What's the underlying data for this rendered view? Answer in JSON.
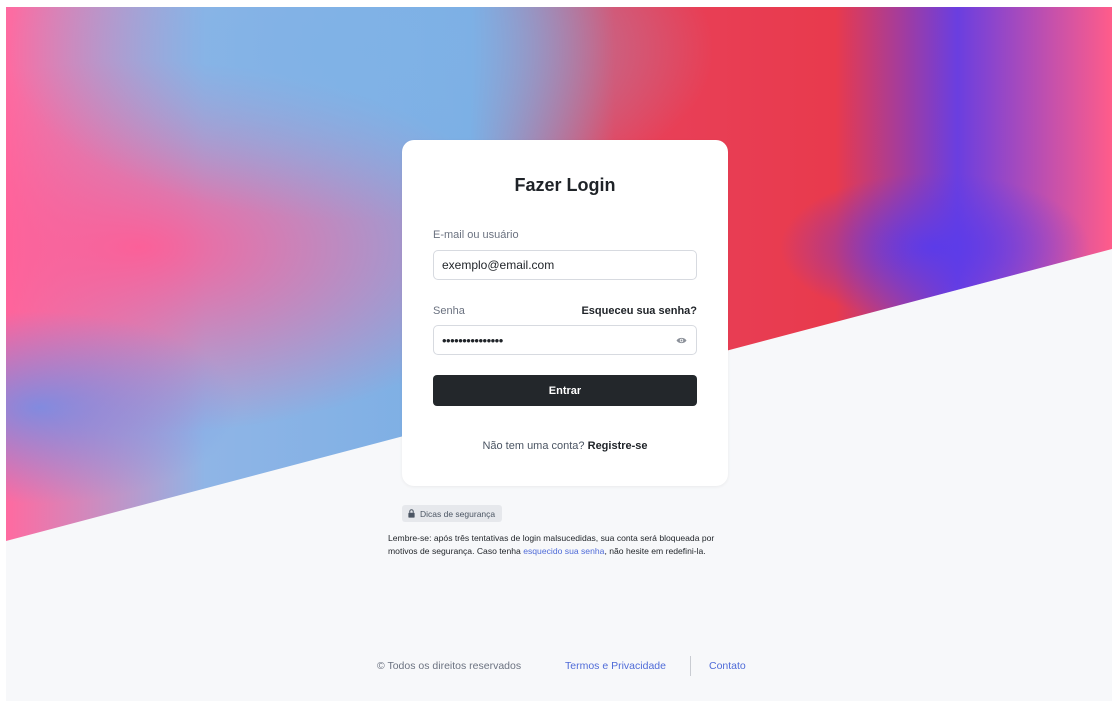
{
  "colors": {
    "accent": "#4f6bd8",
    "button_bg": "#23272b",
    "page_bg": "#f7f8fa",
    "card_bg": "#ffffff"
  },
  "login_card": {
    "title": "Fazer Login",
    "email_label": "E-mail ou usuário",
    "email_value": "exemplo@email.com",
    "password_label": "Senha",
    "forgot_label": "Esqueceu sua senha?",
    "password_masked": "•••••••••••••••",
    "eye_icon": "eye-icon",
    "submit_label": "Entrar",
    "signup_prompt": "Não tem uma conta?",
    "signup_link": "Registre-se"
  },
  "security_tips": {
    "badge_icon": "lock-icon",
    "badge_label": "Dicas de segurança",
    "text_before": "Lembre-se: após três tentativas de login malsucedidas, sua conta será bloqueada por motivos de segurança. Caso tenha ",
    "text_link": "esquecido sua senha",
    "text_after": ", não hesite em redefini-la."
  },
  "footer": {
    "copyright": "© Todos os direitos reservados",
    "terms": "Termos e Privacidade",
    "contact": "Contato"
  }
}
